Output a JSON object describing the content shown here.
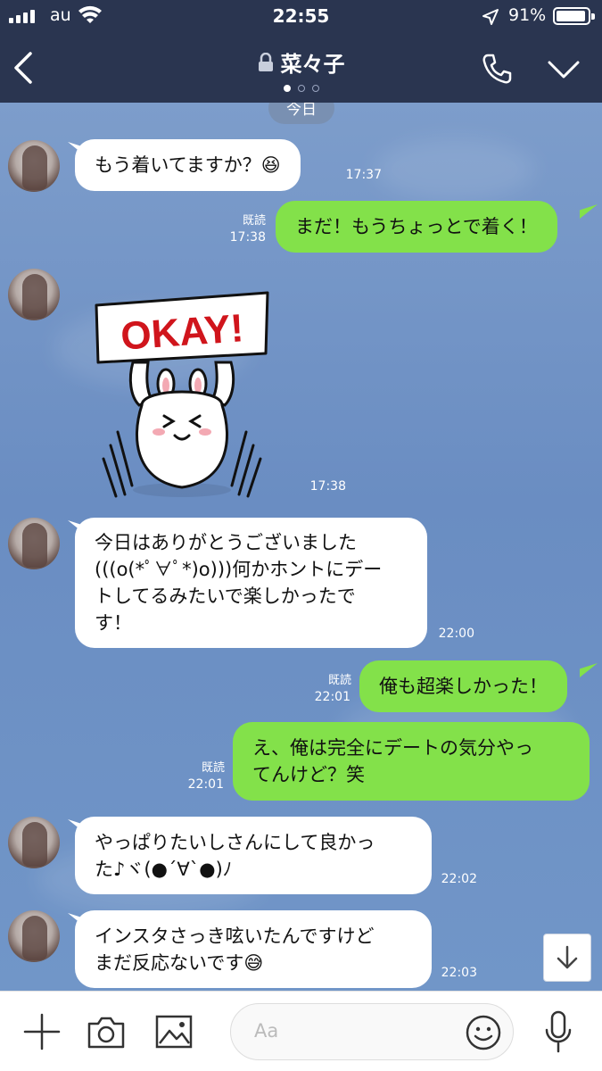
{
  "status_bar": {
    "carrier": "au",
    "time": "22:55",
    "battery": "91%"
  },
  "header": {
    "title": "菜々子"
  },
  "chat": {
    "date_label": "今日",
    "messages": [
      {
        "side": "in",
        "text": "もう着いてますか？😆",
        "time": "17:37"
      },
      {
        "side": "out",
        "text": "まだ！もうちょっとで着く！",
        "read": "既読",
        "time": "17:38"
      },
      {
        "side": "in",
        "sticker": "okay-sticker",
        "sticker_text": "OKAY!",
        "time": "17:38"
      },
      {
        "side": "in",
        "lines": [
          "今日はありがとうございました",
          "(((o(*ﾟ∀ﾟ*)o)))何かホントにデー",
          "トしてるみたいで楽しかったで",
          "す！"
        ],
        "time": "22:00"
      },
      {
        "side": "out",
        "text": "俺も超楽しかった！",
        "read": "既読",
        "time": "22:01"
      },
      {
        "side": "out",
        "lines": [
          "え、俺は完全にデートの気分やっ",
          "てんけど？笑"
        ],
        "read": "既読",
        "time": "22:01"
      },
      {
        "side": "in",
        "lines": [
          "やっぱりたいしさんにして良かっ",
          "た♪ヾ(●´∀`●)ﾉ"
        ],
        "time": "22:02"
      },
      {
        "side": "in",
        "lines": [
          "インスタさっき呟いたんですけど",
          "まだ反応ないです😅"
        ],
        "time": "22:03"
      }
    ]
  },
  "input_bar": {
    "placeholder": "Aa"
  },
  "colors": {
    "header_bg": "#2a3550",
    "outgoing_bubble": "#83e14a",
    "incoming_bubble": "#ffffff",
    "chat_bg": "#7196c8"
  }
}
